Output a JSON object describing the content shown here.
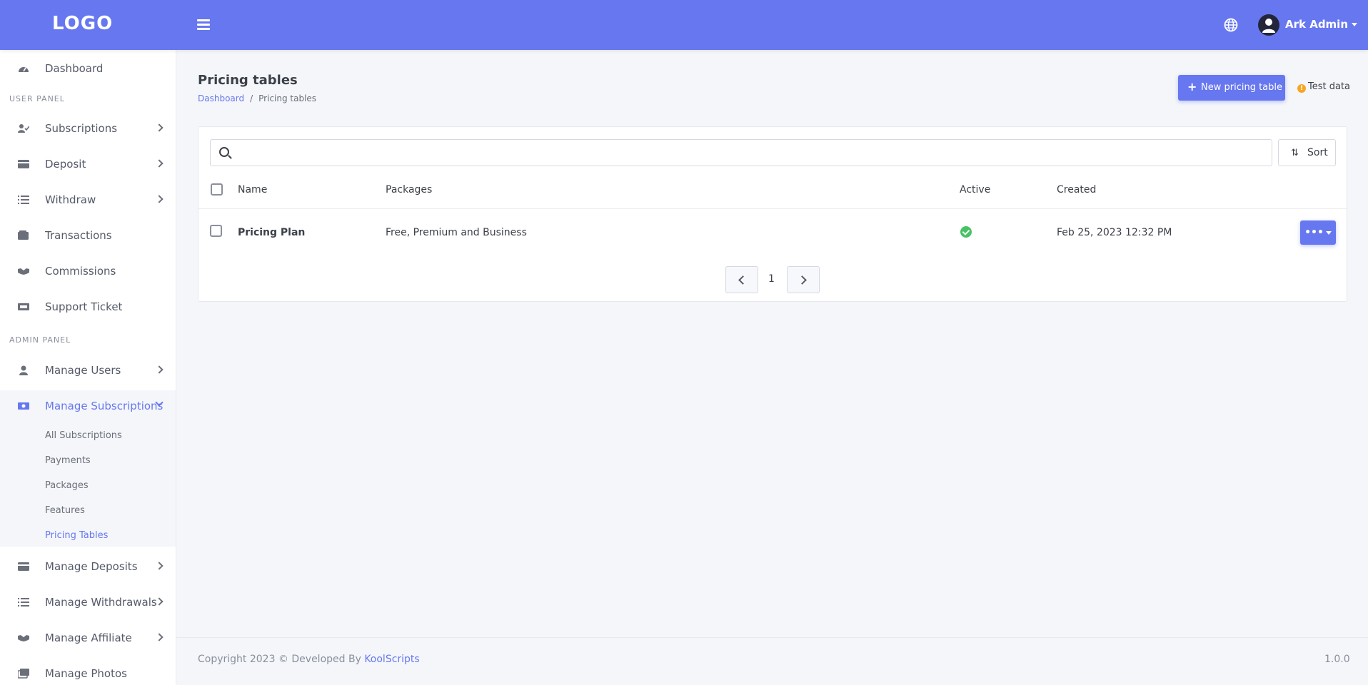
{
  "topbar": {
    "logo": "LOGO",
    "user_name": "Ark Admin"
  },
  "sidebar": {
    "dashboard": "Dashboard",
    "user_panel_heading": "USER PANEL",
    "user_items": [
      "Subscriptions",
      "Deposit",
      "Withdraw",
      "Transactions",
      "Commissions",
      "Support Ticket"
    ],
    "admin_panel_heading": "ADMIN PANEL",
    "admin_items": [
      "Manage Users",
      "Manage Subscriptions",
      "Manage Deposits",
      "Manage Withdrawals",
      "Manage Affiliate",
      "Manage Photos"
    ],
    "submenu": [
      "All Subscriptions",
      "Payments",
      "Packages",
      "Features",
      "Pricing Tables"
    ],
    "active_submenu": "Pricing Tables"
  },
  "page": {
    "title": "Pricing tables",
    "breadcrumb": [
      "Dashboard",
      "Pricing tables"
    ],
    "new_button": "New pricing table",
    "test_data": "Test data"
  },
  "table": {
    "search_placeholder": "",
    "sort_label": "Sort",
    "columns": [
      "Name",
      "Packages",
      "Active",
      "Created"
    ],
    "rows": [
      {
        "name": "Pricing Plan",
        "packages": "Free, Premium and Business",
        "active": true,
        "created": "Feb 25, 2023 12:32 PM"
      }
    ],
    "current_page": "1"
  },
  "footer": {
    "copyright": "Copyright 2023 © Developed By ",
    "developer": "KoolScripts",
    "version": "1.0.0"
  },
  "colors": {
    "primary": "#6777ef",
    "success": "#47c363",
    "warning": "#f6a623"
  }
}
